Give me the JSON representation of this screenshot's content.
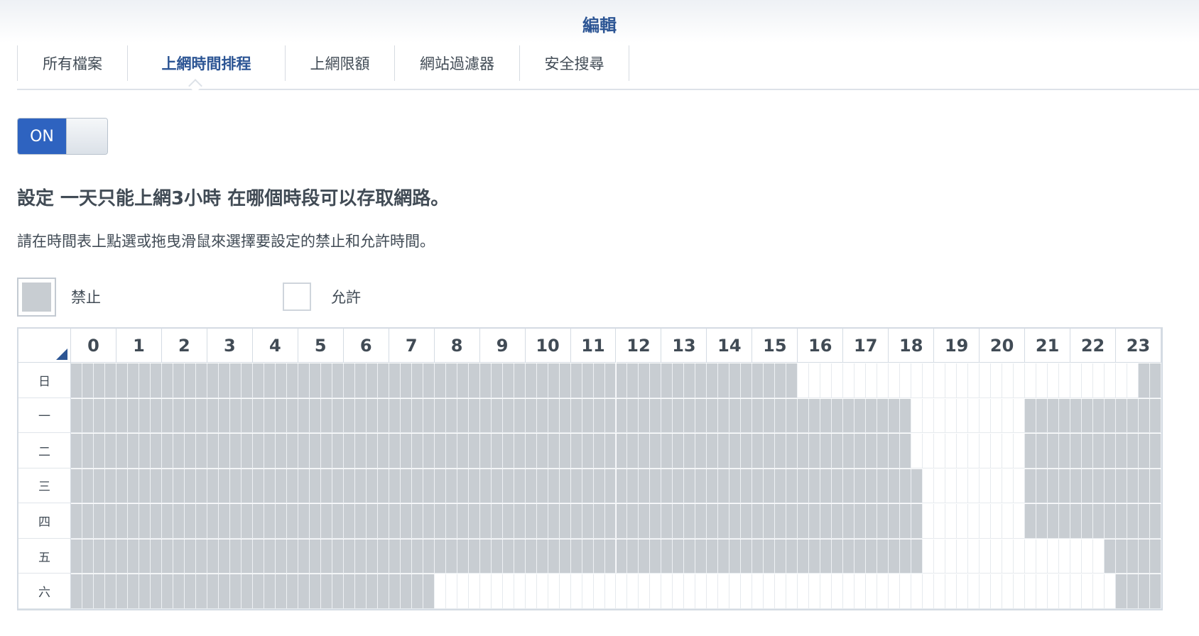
{
  "window": {
    "title": "編輯"
  },
  "tabs": [
    {
      "label": "所有檔案",
      "active": false
    },
    {
      "label": "上網時間排程",
      "active": true
    },
    {
      "label": "上網限額",
      "active": false
    },
    {
      "label": "網站過濾器",
      "active": false
    },
    {
      "label": "安全搜尋",
      "active": false
    }
  ],
  "toggle": {
    "label": "ON",
    "state": "on",
    "color": "#2e63c0"
  },
  "heading": "設定 一天只能上網3小時 在哪個時段可以存取網路。",
  "description": "請在時間表上點選或拖曳滑鼠來選擇要設定的禁止和允許時間。",
  "legend": {
    "deny": {
      "label": "禁止",
      "color": "#c8cdd2"
    },
    "allow": {
      "label": "允許",
      "color": "#ffffff"
    }
  },
  "schedule": {
    "hours": [
      "0",
      "1",
      "2",
      "3",
      "4",
      "5",
      "6",
      "7",
      "8",
      "9",
      "10",
      "11",
      "12",
      "13",
      "14",
      "15",
      "16",
      "17",
      "18",
      "19",
      "20",
      "21",
      "22",
      "23"
    ],
    "slots_per_hour": 4,
    "days": [
      {
        "label": "日",
        "allowed_slots": [
          [
            64,
            94
          ]
        ]
      },
      {
        "label": "一",
        "allowed_slots": [
          [
            74,
            84
          ]
        ]
      },
      {
        "label": "二",
        "allowed_slots": [
          [
            74,
            84
          ]
        ]
      },
      {
        "label": "三",
        "allowed_slots": [
          [
            75,
            84
          ]
        ]
      },
      {
        "label": "四",
        "allowed_slots": [
          [
            75,
            84
          ]
        ]
      },
      {
        "label": "五",
        "allowed_slots": [
          [
            75,
            91
          ]
        ]
      },
      {
        "label": "六",
        "allowed_slots": [
          [
            32,
            92
          ]
        ]
      }
    ]
  }
}
